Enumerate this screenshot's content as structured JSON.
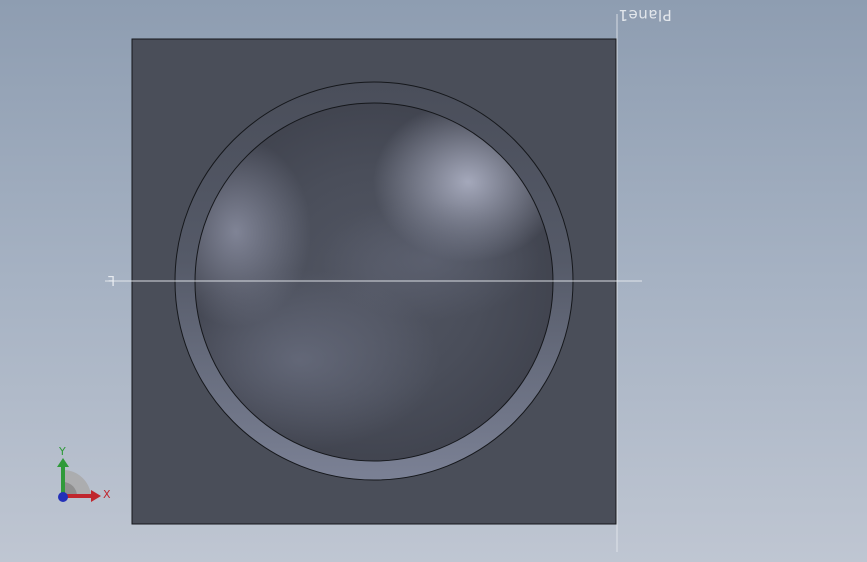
{
  "viewport": {
    "plane_top_label": "Plane1",
    "plane_left_label": "F"
  },
  "triad": {
    "x_label": "X",
    "y_label": "Y",
    "x_color": "#c0262d",
    "y_color": "#2f9a3a",
    "z_color": "#2330b8"
  },
  "colors": {
    "block_face": "#4a4e59",
    "ring_outer": "#777d90",
    "dome_highlight": "#a7abbe",
    "plane_line": "#e8ebf0"
  },
  "icons": {
    "triad": "axis-triad-icon"
  }
}
